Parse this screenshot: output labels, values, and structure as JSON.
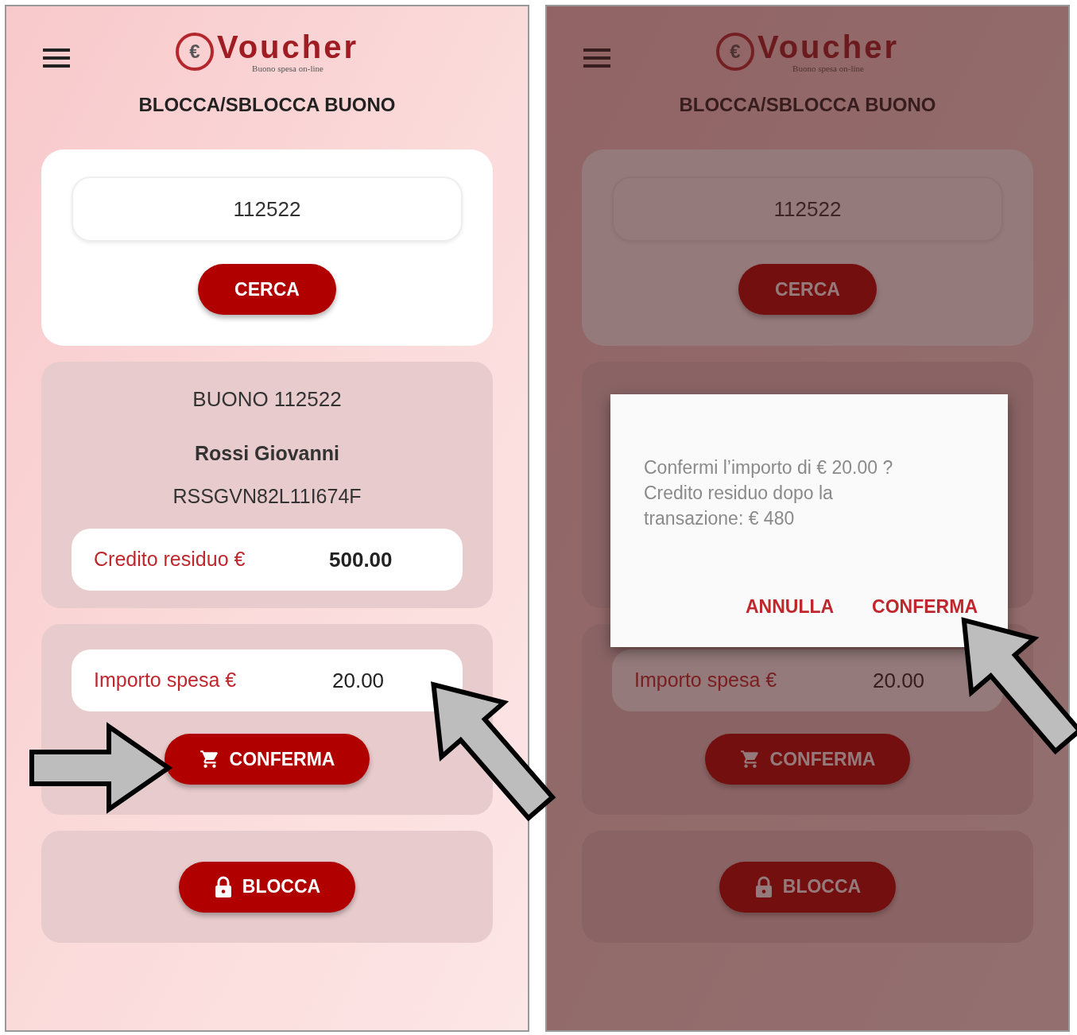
{
  "screens": [
    {
      "dimmed": false,
      "header": {
        "logo_symbol": "€",
        "logo_text": "Voucher",
        "logo_tagline": "Buono spesa on-line",
        "title": "BLOCCA/SBLOCCA BUONO"
      },
      "search": {
        "value": "112522",
        "button": "CERCA"
      },
      "voucher": {
        "title": "BUONO 112522",
        "holder": "Rossi Giovanni",
        "tax_code": "RSSGVN82L11I674F",
        "credit_label": "Credito residuo €",
        "credit_value": "500.00"
      },
      "spend": {
        "label": "Importo spesa €",
        "value": "20.00",
        "button": "CONFERMA"
      },
      "lock": {
        "button": "BLOCCA"
      }
    },
    {
      "dimmed": true,
      "header": {
        "logo_symbol": "€",
        "logo_text": "Voucher",
        "logo_tagline": "Buono spesa on-line",
        "title": "BLOCCA/SBLOCCA BUONO"
      },
      "search": {
        "value": "112522",
        "button": "CERCA"
      },
      "spend": {
        "label": "Importo spesa €",
        "value": "20.00",
        "button": "CONFERMA"
      },
      "lock": {
        "button": "BLOCCA"
      },
      "dialog": {
        "message": "Confermi l’importo di € 20.00 ? Credito residuo dopo la transazione: € 480",
        "buttons": [
          "ANNULLA",
          "CONFERMA"
        ]
      }
    }
  ]
}
